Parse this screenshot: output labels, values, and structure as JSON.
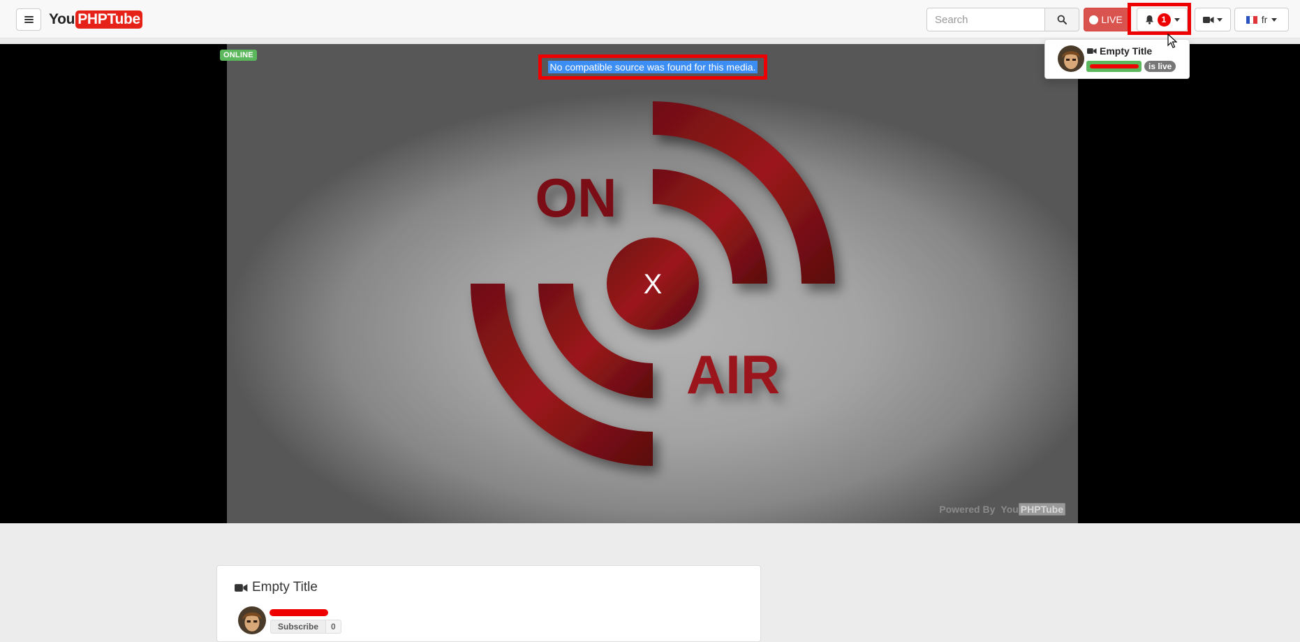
{
  "header": {
    "logo_you": "You",
    "logo_tube": "PHPTube",
    "search_placeholder": "Search",
    "live_label": "LIVE",
    "notification_count": "1",
    "language": "fr"
  },
  "player": {
    "status_badge": "ONLINE",
    "error_message": "No compatible source was found for this media.",
    "onair_top": "ON",
    "onair_bottom": "AIR",
    "center_mark": "X",
    "powered_by": "Powered By",
    "powered_logo_you": "You",
    "powered_logo_tube": "PHPTube"
  },
  "notification_dropdown": {
    "title": "Empty Title",
    "status": "is live"
  },
  "video": {
    "title": "Empty Title",
    "subscribe_label": "Subscribe",
    "subscriber_count": "0"
  },
  "colors": {
    "brand_red": "#e62117",
    "live_red": "#d9534f",
    "online_green": "#5cb85c",
    "highlight_red": "#ee0000",
    "selection_blue": "#3c8ef5"
  }
}
